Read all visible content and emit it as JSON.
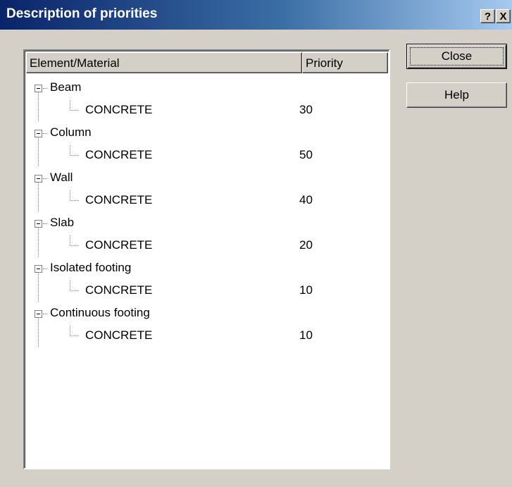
{
  "window": {
    "title": "Description of priorities",
    "help_button": "?",
    "close_button": "X"
  },
  "list": {
    "columns": [
      "Element/Material",
      "Priority"
    ],
    "groups": [
      {
        "element": "Beam",
        "material": "CONCRETE",
        "priority": "30"
      },
      {
        "element": "Column",
        "material": "CONCRETE",
        "priority": "50"
      },
      {
        "element": "Wall",
        "material": "CONCRETE",
        "priority": "40"
      },
      {
        "element": "Slab",
        "material": "CONCRETE",
        "priority": "20"
      },
      {
        "element": "Isolated footing",
        "material": "CONCRETE",
        "priority": "10"
      },
      {
        "element": "Continuous footing",
        "material": "CONCRETE",
        "priority": "10"
      }
    ]
  },
  "buttons": {
    "close": "Close",
    "help": "Help"
  }
}
